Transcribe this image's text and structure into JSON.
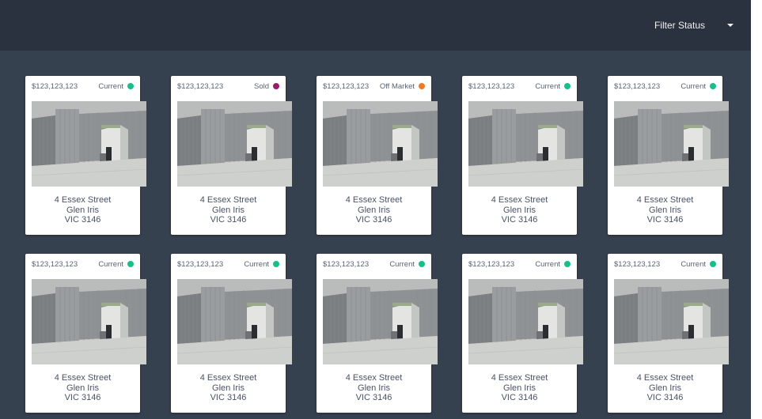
{
  "header": {
    "filter_label": "Filter Status",
    "caret_icon": "caret-down-icon"
  },
  "status_colors": {
    "Current": "#17c08a",
    "Sold": "#9b1b6b",
    "Off Market": "#f07a22"
  },
  "cards": [
    {
      "price": "$123,123,123",
      "status": "Current",
      "street": "4 Essex Street",
      "suburb": "Glen Iris",
      "postcode": "VIC 3146"
    },
    {
      "price": "$123,123,123",
      "status": "Sold",
      "street": "4 Essex Street",
      "suburb": "Glen Iris",
      "postcode": "VIC 3146"
    },
    {
      "price": "$123,123,123",
      "status": "Off Market",
      "street": "4 Essex Street",
      "suburb": "Glen Iris",
      "postcode": "VIC 3146"
    },
    {
      "price": "$123,123,123",
      "status": "Current",
      "street": "4 Essex Street",
      "suburb": "Glen Iris",
      "postcode": "VIC 3146"
    },
    {
      "price": "$123,123,123",
      "status": "Current",
      "street": "4 Essex Street",
      "suburb": "Glen Iris",
      "postcode": "VIC 3146"
    },
    {
      "price": "$123,123,123",
      "status": "Current",
      "street": "4 Essex Street",
      "suburb": "Glen Iris",
      "postcode": "VIC 3146"
    },
    {
      "price": "$123,123,123",
      "status": "Current",
      "street": "4 Essex Street",
      "suburb": "Glen Iris",
      "postcode": "VIC 3146"
    },
    {
      "price": "$123,123,123",
      "status": "Current",
      "street": "4 Essex Street",
      "suburb": "Glen Iris",
      "postcode": "VIC 3146"
    },
    {
      "price": "$123,123,123",
      "status": "Current",
      "street": "4 Essex Street",
      "suburb": "Glen Iris",
      "postcode": "VIC 3146"
    },
    {
      "price": "$123,123,123",
      "status": "Current",
      "street": "4 Essex Street",
      "suburb": "Glen Iris",
      "postcode": "VIC 3146"
    }
  ]
}
